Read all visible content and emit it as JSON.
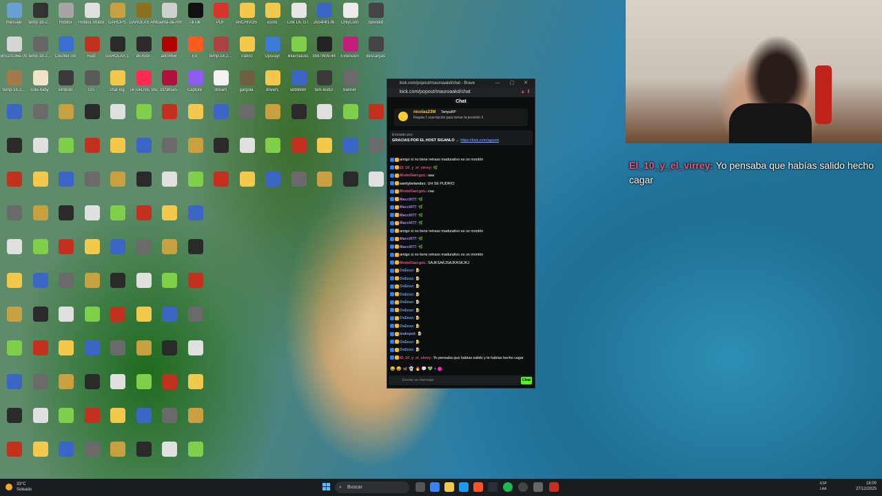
{
  "desktop_icons": [
    {
      "label": "mensaje",
      "color": "#6aa0d0"
    },
    {
      "label": "temp-18-2...",
      "color": "#333333"
    },
    {
      "label": "Roblox",
      "color": "#a5a5a5"
    },
    {
      "label": "Roblox Studio",
      "color": "#e0e0e0"
    },
    {
      "label": "GAROPS",
      "color": "#c8a040"
    },
    {
      "label": "GAROLAS AWARDS",
      "color": "#8a7020"
    },
    {
      "label": "cuenta-de-RR",
      "color": "#cfcfcf"
    },
    {
      "label": "TikTok",
      "color": "#111111"
    },
    {
      "label": "PDF",
      "color": "#d9342b"
    },
    {
      "label": "ARCHIVOS",
      "color": "#f2c94c"
    },
    {
      "label": "icono",
      "color": "#f2c94c"
    },
    {
      "label": "Link DE GT",
      "color": "#e6e6e6"
    },
    {
      "label": "2e54f4f1-fb",
      "color": "#3c66c5"
    },
    {
      "label": "OnlyCom",
      "color": "#ececec"
    },
    {
      "label": "Spendid",
      "color": "#444444"
    },
    {
      "label": "8c5231d6e-00",
      "color": "#d6d6d6"
    },
    {
      "label": "temp-18-2...",
      "color": "#666666"
    },
    {
      "label": "Counter-Str",
      "color": "#3a6fd0"
    },
    {
      "label": "Rust",
      "color": "#c4301e"
    },
    {
      "label": "GAROLAS 1",
      "color": "#2a2a2a"
    },
    {
      "label": "ek-Kick",
      "color": "#2c2c2c"
    },
    {
      "label": "adc9456",
      "color": "#b00000"
    },
    {
      "label": "EA",
      "color": "#ff5a1f"
    },
    {
      "label": "temp-18-2...",
      "color": "#aa4444"
    },
    {
      "label": "Trafico",
      "color": "#f2c94c"
    },
    {
      "label": "Upscayl",
      "color": "#3c7bd6"
    },
    {
      "label": "BlueStacks",
      "color": "#7fcf4a"
    },
    {
      "label": "3bd7f409-44",
      "color": "#222222"
    },
    {
      "label": "Extension",
      "color": "#c21f7a"
    },
    {
      "label": "descargas",
      "color": "#444444"
    },
    {
      "label": "temp-18-2...",
      "color": "#a47a4a"
    },
    {
      "label": "cute-baby",
      "color": "#f1e3c9"
    },
    {
      "label": "simbolo",
      "color": "#3a3a3a"
    },
    {
      "label": "GS",
      "color": "#5a5a5a"
    },
    {
      "label": "chat-log",
      "color": "#f2c94c"
    },
    {
      "label": "TikTokLIVE Studio",
      "color": "#fe2c55"
    },
    {
      "label": "91f3b5e5",
      "color": "#b0103c"
    },
    {
      "label": "Capture",
      "color": "#8d5cf6"
    },
    {
      "label": "stream",
      "color": "#f2f2f2"
    },
    {
      "label": "gargola",
      "color": "#6e5f42"
    },
    {
      "label": "drivers",
      "color": "#f2c94c"
    },
    {
      "label": "5bb8980",
      "color": "#3c66c5"
    },
    {
      "label": "fam-textur",
      "color": "#3a3a3a"
    },
    {
      "label": "banner",
      "color": "#6a6a6a"
    }
  ],
  "chat_window": {
    "title": "kick.com/popout/mauroaakd/chat - Brave",
    "url": "kick.com/popout/mauroaakd/chat",
    "header": "Chat",
    "sub_banner": {
      "top": "nicolas23M",
      "middle": "TampaRP",
      "bottom": "Regala 1 suscripción para tomar la posición 3"
    },
    "pinned": {
      "by": "Enviado por:",
      "text": "GRACIAS POR EL HOST SIGANLO →",
      "link": "https://kick.com/agruck"
    },
    "messages": [
      {
        "user": "",
        "color": "#e15b7c",
        "text": "amigo si no tiene retraso madurativo es un montón"
      },
      {
        "user": "El_10_y_el_virrey:",
        "color": "#e15b7c",
        "text": "🌿"
      },
      {
        "user": "ModelGarcgoL:",
        "color": "#e15b7c",
        "text": "aaa"
      },
      {
        "user": "santybelandez:",
        "color": "#d8d8d8",
        "text": "UH SE PUDRIO"
      },
      {
        "user": "ModelGarcgoL:",
        "color": "#e15b7c",
        "text": "caa"
      },
      {
        "user": "Maccill77:",
        "color": "#b987ff",
        "text": "🌿"
      },
      {
        "user": "Maccill77:",
        "color": "#b987ff",
        "text": "🌿"
      },
      {
        "user": "Maccill77:",
        "color": "#b987ff",
        "text": "🌿"
      },
      {
        "user": "Maccill77:",
        "color": "#b987ff",
        "text": "🌿"
      },
      {
        "user": "",
        "color": "#e15b7c",
        "text": "amigo si no tiene retraso madurativo es un montón"
      },
      {
        "user": "Maccill77:",
        "color": "#b987ff",
        "text": "🌿"
      },
      {
        "user": "Maccill77:",
        "color": "#b987ff",
        "text": "🌿"
      },
      {
        "user": "",
        "color": "#e15b7c",
        "text": "amigo si no tiene retraso madurativo es un montón"
      },
      {
        "user": "ModelGarcgoL:",
        "color": "#e15b7c",
        "text": "SAJKSAKJSAJKASKJKJ"
      },
      {
        "user": "OsEnzz:",
        "color": "#5aa9ff",
        "text": "🍺"
      },
      {
        "user": "OsEnzz:",
        "color": "#5aa9ff",
        "text": "🍺"
      },
      {
        "user": "OsEnzz:",
        "color": "#5aa9ff",
        "text": "🍺"
      },
      {
        "user": "OsEnzz:",
        "color": "#5aa9ff",
        "text": "🍺"
      },
      {
        "user": "OsEnzz:",
        "color": "#5aa9ff",
        "text": "🍺"
      },
      {
        "user": "OsEnzz:",
        "color": "#5aa9ff",
        "text": "🍺"
      },
      {
        "user": "OsEnzz:",
        "color": "#5aa9ff",
        "text": "🍺"
      },
      {
        "user": "OsEnzz:",
        "color": "#5aa9ff",
        "text": "🍺"
      },
      {
        "user": "leukspot:",
        "color": "#8fa4ff",
        "text": "🍺"
      },
      {
        "user": "OsEnzz:",
        "color": "#5aa9ff",
        "text": "🍺"
      },
      {
        "user": "OsEnzz:",
        "color": "#5aa9ff",
        "text": "🍺"
      },
      {
        "user": "El_10_y_el_virrey:",
        "color": "#e15b7c",
        "text": "Yo pensaba que habías salido y te habías hecho cagar"
      }
    ],
    "input_placeholder": "Enviar un mensaje",
    "chat_button": "Chat"
  },
  "overlay_message": {
    "user": "El_10_y_el_virrey:",
    "text": "Yo pensaba que habías salido hecho cagar"
  },
  "taskbar": {
    "weather_temp": "33°C",
    "weather_desc": "Soleado",
    "search_placeholder": "Buscar",
    "lang_top": "ESP",
    "lang_bottom": "LAA",
    "time": "18:00",
    "date": "27/12/2025"
  },
  "colors": {
    "kick_green": "#53fc18",
    "chat_bg": "#0b0e0f",
    "overlay_user": "#e15b7c"
  }
}
